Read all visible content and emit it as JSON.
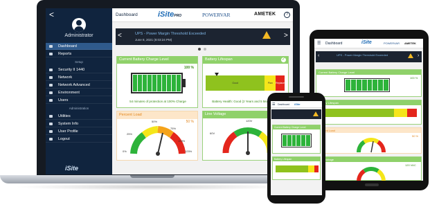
{
  "app": {
    "title": "Dashboard",
    "isite_logo": "iSite",
    "isite_pro": "PRO",
    "brand_powervar": "POWERVAR",
    "brand_ametek": "AMETEK",
    "help": "?"
  },
  "sidebar": {
    "back": "<",
    "role": "Administrator",
    "items": [
      {
        "label": "Dashboard",
        "active": true
      },
      {
        "label": "Reports"
      },
      {
        "label": "Security II 1440"
      },
      {
        "label": "Network"
      },
      {
        "label": "Network Advanced"
      },
      {
        "label": "Environment"
      },
      {
        "label": "Users"
      },
      {
        "label": "Utilities"
      },
      {
        "label": "System Info"
      },
      {
        "label": "User Profile"
      },
      {
        "label": "Logout"
      }
    ],
    "section_setup": "Setup",
    "section_admin": "Administration",
    "logo": "iSite"
  },
  "alert": {
    "title": "UPS - Power Margin Threshold Exceeded",
    "date": "June 8, 2021 (8:03:24 PM)",
    "prev": "<",
    "next": ">"
  },
  "cards": {
    "battery": {
      "title": "Current Battery Charge Level",
      "percent": "100 %",
      "footer": "54 minutes of protection at 100% Charge",
      "charge": 1.0
    },
    "lifespan": {
      "title": "Battery Lifespan",
      "segments": [
        "Good",
        "Plan",
        "Replace"
      ],
      "footer": "Battery Health: Good (2 Years and 5 Months Left)"
    },
    "load": {
      "title": "Percent Load",
      "percent": "50 %",
      "ticks": [
        "0%",
        "25%",
        "50%",
        "75%",
        "100%",
        "125%"
      ]
    },
    "voltage": {
      "title": "Line Voltage",
      "ticks": [
        "60V",
        "120V"
      ]
    }
  },
  "tablet": {
    "title": "Dashboard",
    "alert_title": "UPS - Power Margin Threshold Exceeded",
    "battery_title": "Current Battery Charge Level",
    "battery_pct": "100 %",
    "lifespan_title": "Battery Lifespan",
    "load_title": "Percent Load",
    "load_pct": "50 %",
    "voltage_title": "Line Voltage",
    "voltage_val": "120 VAC"
  },
  "phone": {
    "title": "Dashboard",
    "battery_title": "Current Battery Charge Level",
    "lifespan_title": "Battery Lifespan"
  },
  "colors": {
    "sidebar": "#10243e",
    "card_header_ok": "#8fd16a",
    "card_header_warn": "#fde6c9",
    "battery_fill": "#2db33a",
    "warn": "#f2b824"
  }
}
